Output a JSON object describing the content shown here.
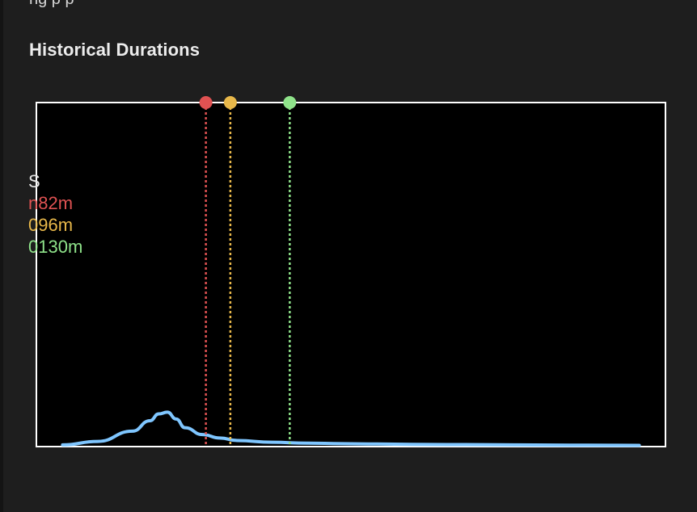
{
  "top_cut_text": "ng                              p   p",
  "section": {
    "title": "Historical Durations"
  },
  "chart_data": {
    "type": "area",
    "title": "",
    "xlabel": "",
    "ylabel": "",
    "grid": false,
    "background": "#000000",
    "frame_color": "#ffffff",
    "curve_color": "#7fc6ff",
    "x": [
      0,
      20,
      40,
      50,
      55,
      60,
      65,
      70,
      80,
      90,
      100,
      120,
      140,
      160,
      180,
      200,
      220,
      240,
      260,
      280,
      300,
      330
    ],
    "values": [
      0.01,
      0.03,
      0.09,
      0.15,
      0.19,
      0.2,
      0.16,
      0.11,
      0.07,
      0.05,
      0.035,
      0.025,
      0.02,
      0.017,
      0.015,
      0.013,
      0.012,
      0.011,
      0.01,
      0.009,
      0.008,
      0.007
    ],
    "xlim": [
      -15,
      345
    ],
    "ylim": [
      0,
      2.0
    ],
    "markers": [
      {
        "value": 82,
        "color": "#e05252",
        "label": "n82m"
      },
      {
        "value": 96,
        "color": "#e8b84a",
        "label": "096m"
      },
      {
        "value": 130,
        "color": "#8fe38a",
        "label": "0130m"
      }
    ],
    "legend": {
      "placement": "left",
      "title": "S"
    }
  }
}
